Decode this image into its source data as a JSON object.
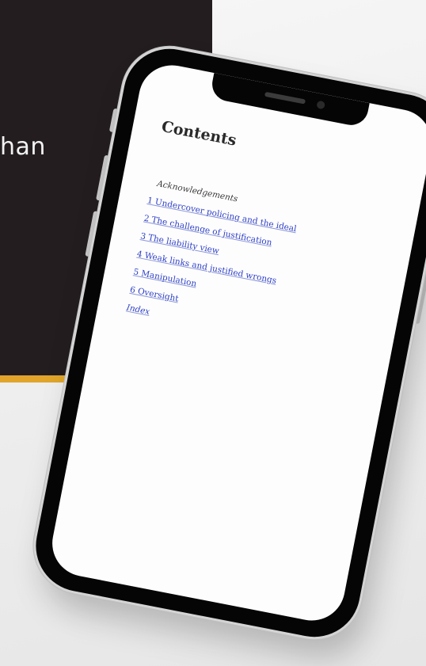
{
  "background": {
    "book_cover": {
      "visible_text": "han",
      "colors": {
        "cover": "#231d1f",
        "stripe": "#e0a52a",
        "text": "#f2f2f2"
      }
    }
  },
  "phone": {
    "colors": {
      "frame": "#050505",
      "screen": "#fdfdfd",
      "link": "#2d3fc7"
    },
    "screen": {
      "title": "Contents",
      "items": [
        {
          "label": "Acknowledgements",
          "link": false
        },
        {
          "label": "1 Undercover policing and the ideal",
          "link": true
        },
        {
          "label": "2 The challenge of justification",
          "link": true
        },
        {
          "label": "3 The liability view",
          "link": true
        },
        {
          "label": "4 Weak links and justified wrongs",
          "link": true
        },
        {
          "label": "5 Manipulation",
          "link": true
        },
        {
          "label": "6 Oversight",
          "link": true
        },
        {
          "label": "Index",
          "link": true
        }
      ]
    }
  }
}
